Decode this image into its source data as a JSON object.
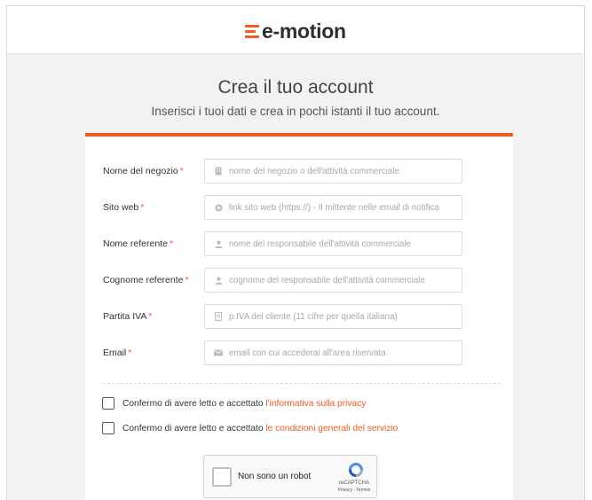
{
  "brand": {
    "name": "e-motion",
    "accent_color": "#f05a23"
  },
  "header": {
    "title": "Crea il tuo account",
    "subtitle": "Inserisci i tuoi dati e crea in pochi istanti il tuo account."
  },
  "form": {
    "required_mark": "*",
    "fields": [
      {
        "label": "Nome del negozio",
        "placeholder": "nome del negozio o dell'attività commerciale",
        "icon": "building-icon"
      },
      {
        "label": "Sito web",
        "placeholder": "link sito web (https://) - Il mittente nelle email di notifica",
        "icon": "globe-icon"
      },
      {
        "label": "Nome referente",
        "placeholder": "nome del responsabile dell'attività commerciale",
        "icon": "user-icon"
      },
      {
        "label": "Cognome referente",
        "placeholder": "cognome del responsabile dell'attività commerciale",
        "icon": "user-icon"
      },
      {
        "label": "Partita IVA",
        "placeholder": "p.IVA del cliente (11 cifre per quella italiana)",
        "icon": "document-icon"
      },
      {
        "label": "Email",
        "placeholder": "email con cui accederai all'area riservata",
        "icon": "envelope-icon"
      }
    ],
    "consents": [
      {
        "text": "Confermo di avere letto e accettato",
        "link": "l'informativa sulla privacy",
        "checked": false
      },
      {
        "text": "Confermo di avere letto e accettato",
        "link": "le condizioni generali del servizio",
        "checked": false
      }
    ]
  },
  "captcha": {
    "label": "Non sono un robot",
    "brand": "reCAPTCHA",
    "terms": "Privacy - Termini"
  }
}
